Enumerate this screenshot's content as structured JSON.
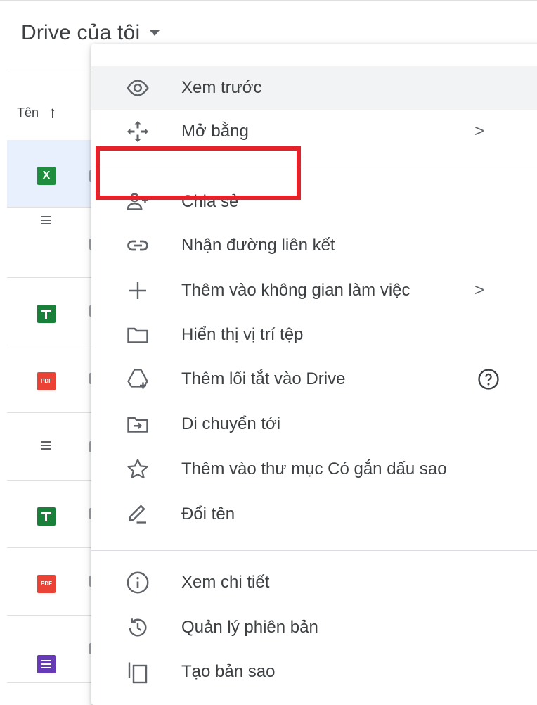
{
  "header": {
    "title": "Drive của tôi"
  },
  "list": {
    "sort_column": "Tên"
  },
  "files": [
    {
      "type": "excel",
      "icon": "excel-file-icon",
      "glyph": "X"
    },
    {
      "type": "doc",
      "icon": "document-file-icon"
    },
    {
      "type": "sheets",
      "icon": "sheets-file-icon"
    },
    {
      "type": "pdf",
      "icon": "pdf-file-icon",
      "glyph": "PDF"
    },
    {
      "type": "doc",
      "icon": "document-file-icon"
    },
    {
      "type": "sheets",
      "icon": "sheets-file-icon"
    },
    {
      "type": "pdf",
      "icon": "pdf-file-icon",
      "glyph": "PDF"
    },
    {
      "type": "forms",
      "icon": "forms-file-icon"
    }
  ],
  "menu": {
    "preview": "Xem trước",
    "open_with": "Mở bằng",
    "share": "Chia sẻ",
    "get_link": "Nhận đường liên kết",
    "add_workspace": "Thêm vào không gian làm việc",
    "show_location": "Hiển thị vị trí tệp",
    "add_shortcut": "Thêm lối tắt vào Drive",
    "move_to": "Di chuyển tới",
    "add_starred": "Thêm vào thư mục Có gắn dấu sao",
    "rename": "Đổi tên",
    "view_details": "Xem chi tiết",
    "manage_versions": "Quản lý phiên bản",
    "make_copy": "Tạo bản sao",
    "submenu_chevron": ">"
  },
  "colors": {
    "highlight_box": "#e5212a",
    "hover_row": "#f1f3f4",
    "selected_row": "#e8f0fe"
  }
}
